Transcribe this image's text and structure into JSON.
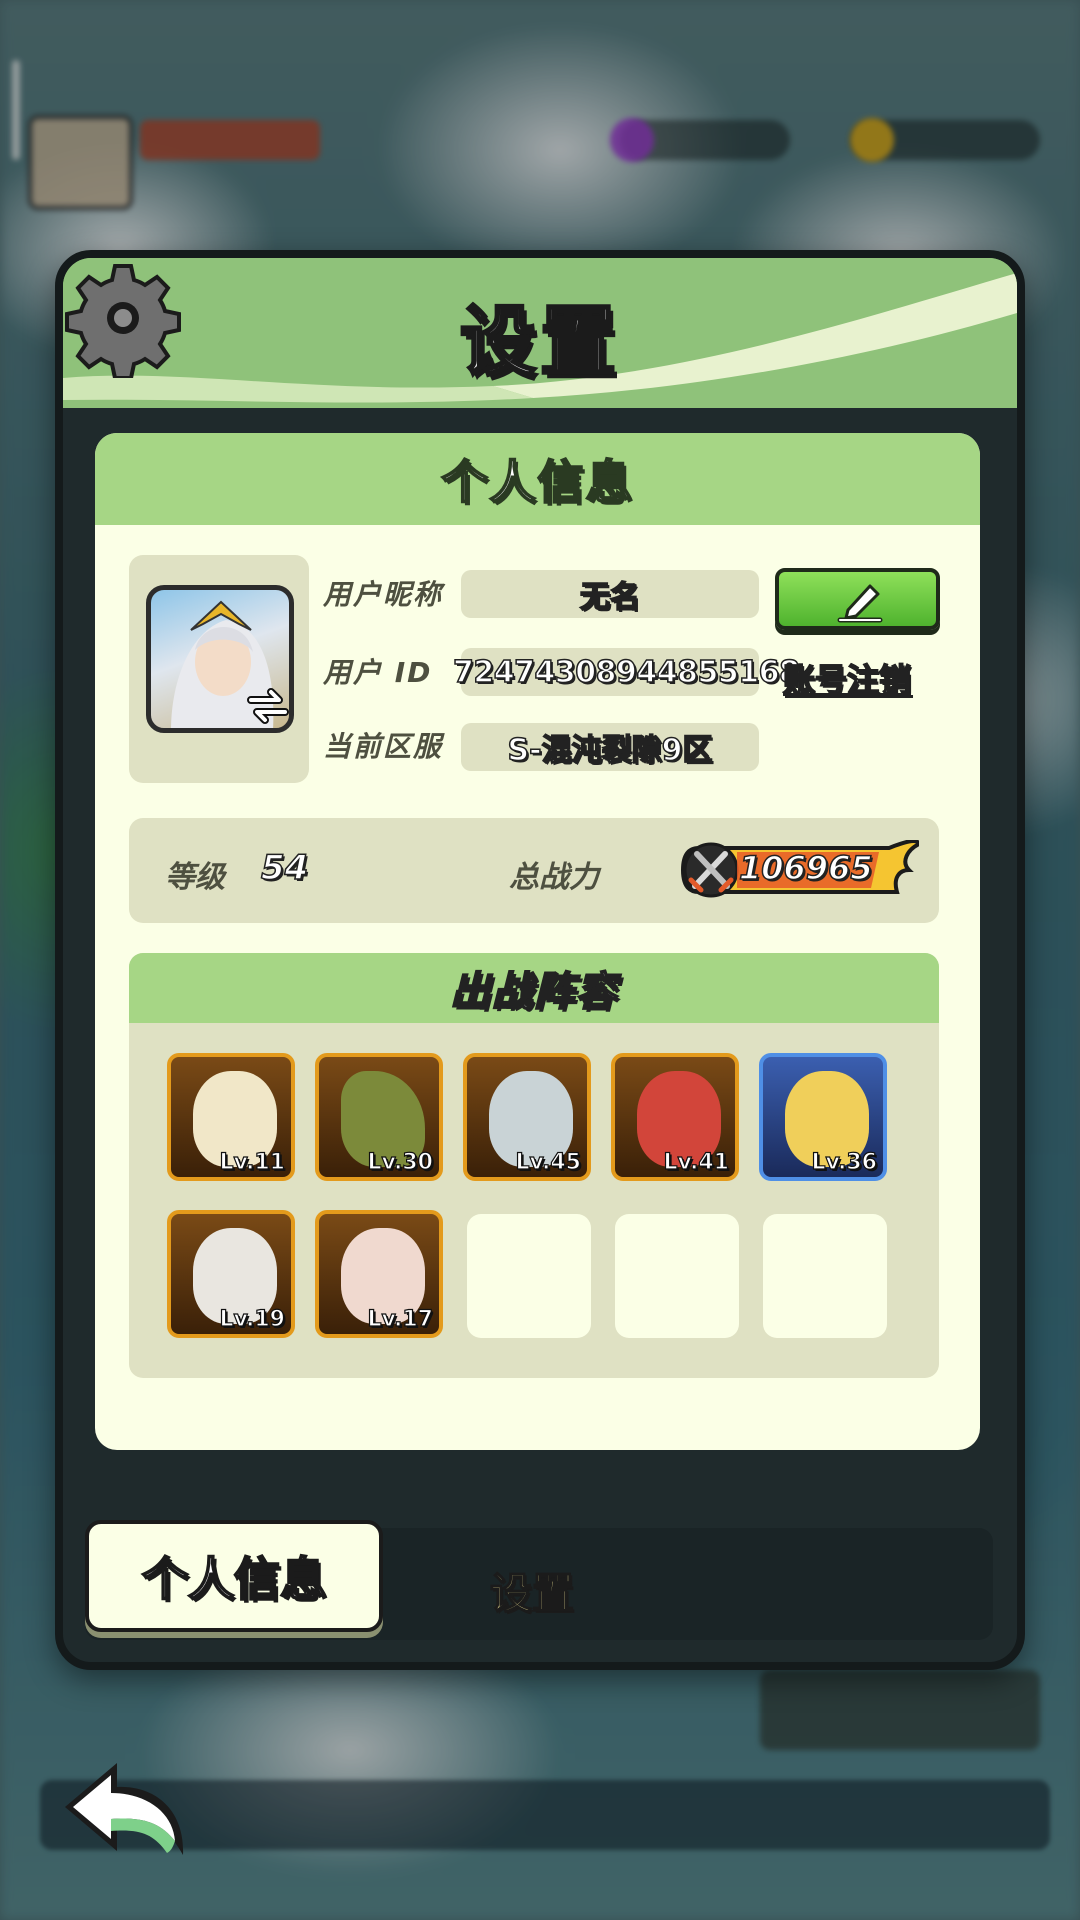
{
  "header": {
    "title": "设置"
  },
  "card": {
    "title": "个人信息"
  },
  "profile": {
    "nickname_label": "用户昵称",
    "nickname": "无名",
    "id_label": "用户 ID",
    "id": "7247430894485​5168",
    "server_label": "当前区服",
    "server": "S-混沌裂隙9区",
    "logout_label": "账号注销"
  },
  "stats": {
    "level_label": "等级",
    "level": "54",
    "power_label": "总战力",
    "power": "106965"
  },
  "lineup": {
    "title": "出战阵容",
    "heroes": [
      {
        "lv": "Lv.11",
        "frame": "orange"
      },
      {
        "lv": "Lv.30",
        "frame": "orange"
      },
      {
        "lv": "Lv.45",
        "frame": "orange"
      },
      {
        "lv": "Lv.41",
        "frame": "orange"
      },
      {
        "lv": "Lv.36",
        "frame": "blue"
      },
      {
        "lv": "Lv.19",
        "frame": "orange"
      },
      {
        "lv": "Lv.17",
        "frame": "orange"
      }
    ],
    "empty_slots": 3
  },
  "tabs": {
    "active": "个人信息",
    "inactive": "设置"
  },
  "icons": [
    "gear-icon",
    "edit-pencil-icon",
    "swap-arrows-icon",
    "crossed-swords-icon",
    "back-arrow-icon"
  ],
  "colors": {
    "accent_green": "#a6d685",
    "card_bg": "#fbffe6",
    "hero_orange": "#e39a1c",
    "hero_blue": "#4f8fe6"
  }
}
